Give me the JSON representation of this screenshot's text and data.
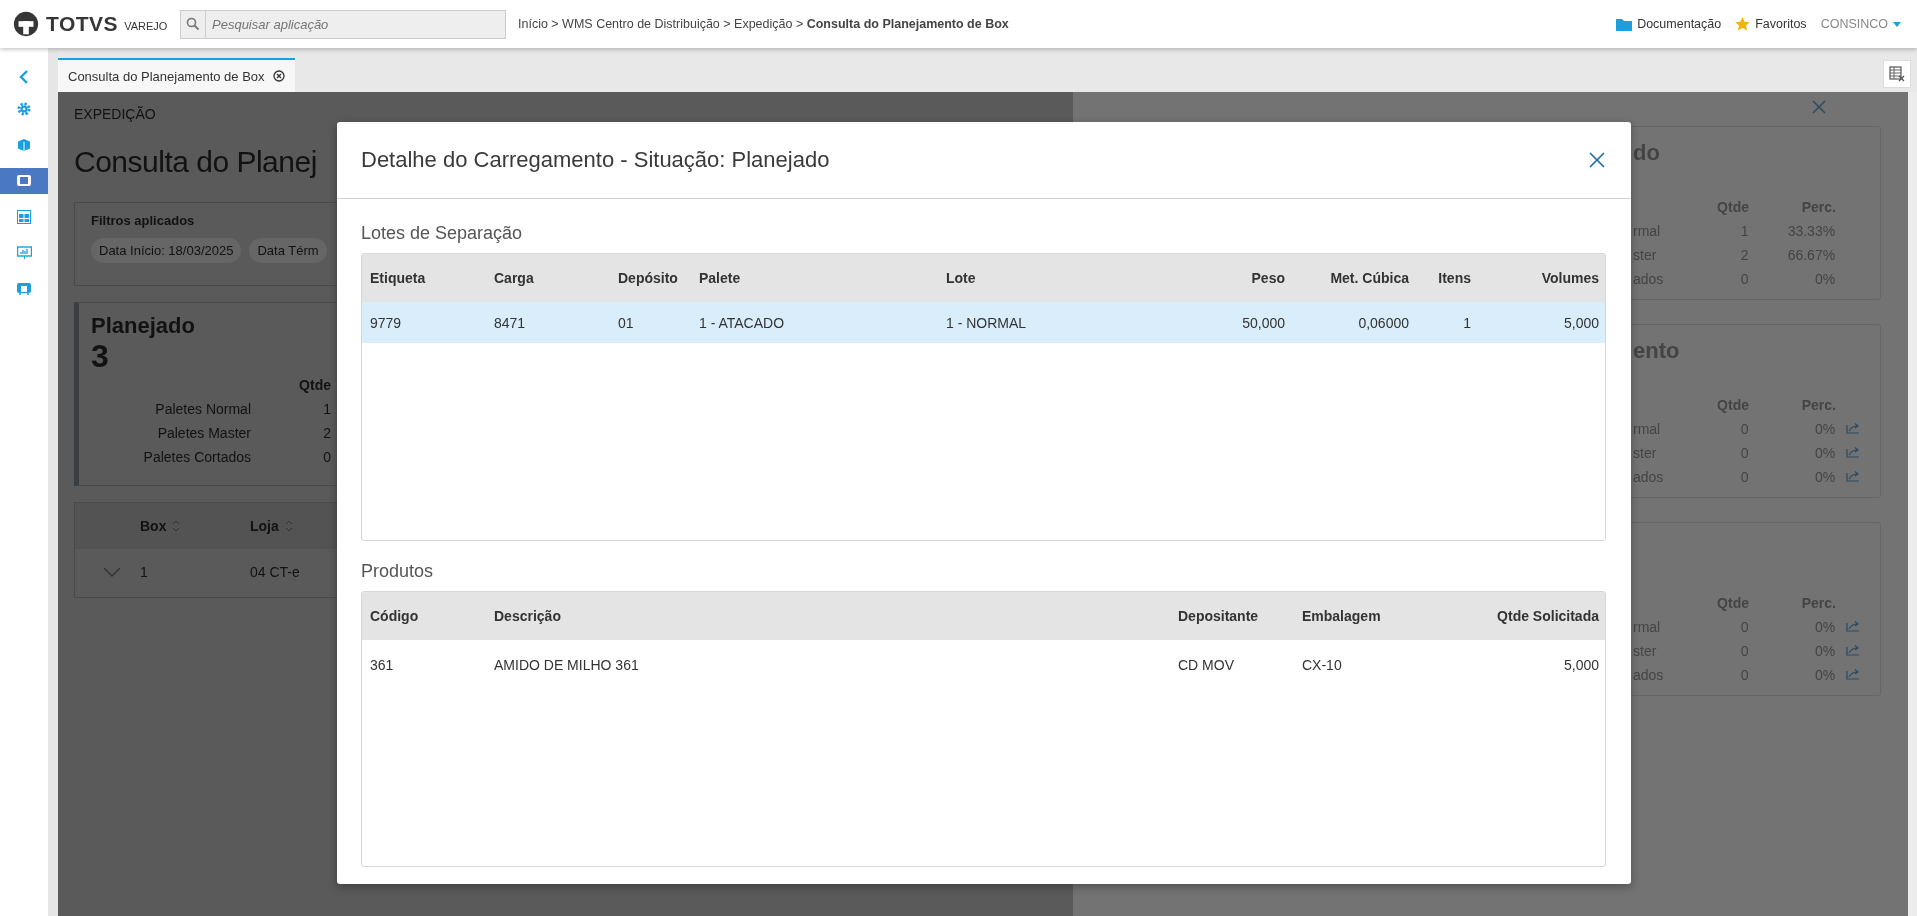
{
  "topbar": {
    "logo": "TOTVS",
    "logo_sub": "VAREJO",
    "search": {
      "placeholder": "Pesquisar aplicação"
    },
    "breadcrumb": "Início > WMS Centro de Distribuição > Expedição > **Consulta do Planejamento de Box**",
    "links": [
      {
        "label": "Documentação",
        "kind": "folder"
      },
      {
        "label": "Favoritos",
        "kind": "star"
      }
    ],
    "user": "CONSINCO"
  },
  "sidebar": {
    "items": [
      {
        "kind": "back",
        "selected": false
      },
      {
        "kind": "gear",
        "selected": false
      },
      {
        "kind": "box",
        "selected": false
      },
      {
        "kind": "screen",
        "selected": true
      },
      {
        "kind": "grid",
        "selected": false
      },
      {
        "kind": "chart",
        "selected": false
      },
      {
        "kind": "monitor",
        "selected": false
      }
    ]
  },
  "tabs": [
    {
      "label": "Consulta do Planejamento de Box",
      "selected": true
    }
  ],
  "page": {
    "section": "EXPEDIÇÃO",
    "title": "Consulta do Planej",
    "filters": {
      "title": "Filtros aplicados",
      "chips": [
        "Data Início: 18/03/2025",
        "Data Térm"
      ]
    },
    "summary": {
      "title": "Planejado",
      "count": "3",
      "column": "Qtde",
      "rows": [
        {
          "label": "Paletes Normal",
          "qtde": "1"
        },
        {
          "label": "Paletes Master",
          "qtde": "2"
        },
        {
          "label": "Paletes Cortados",
          "qtde": "0"
        }
      ]
    },
    "table": {
      "columns": [
        "Box",
        "Loja"
      ],
      "rows": [
        [
          "1",
          "04 CT-e"
        ]
      ]
    }
  },
  "drawer": {
    "cards": [
      {
        "title": "do",
        "columns": [
          "Qtde",
          "Perc."
        ],
        "rows": [
          {
            "label": "rmal",
            "qtde": "1",
            "perc": "33.33%",
            "trend": false
          },
          {
            "label": "ster",
            "qtde": "2",
            "perc": "66.67%",
            "trend": false
          },
          {
            "label": "ados",
            "qtde": "0",
            "perc": "0%",
            "trend": false
          }
        ]
      },
      {
        "title": "ento",
        "columns": [
          "Qtde",
          "Perc."
        ],
        "rows": [
          {
            "label": "rmal",
            "qtde": "0",
            "perc": "0%",
            "trend": true
          },
          {
            "label": "ster",
            "qtde": "0",
            "perc": "0%",
            "trend": true
          },
          {
            "label": "ados",
            "qtde": "0",
            "perc": "0%",
            "trend": true
          }
        ]
      },
      {
        "columns": [
          "Qtde",
          "Perc."
        ],
        "rows": [
          {
            "label": "rmal",
            "qtde": "0",
            "perc": "0%",
            "trend": true
          },
          {
            "label": "ster",
            "qtde": "0",
            "perc": "0%",
            "trend": true
          },
          {
            "label": "ados",
            "qtde": "0",
            "perc": "0%",
            "trend": true
          }
        ]
      }
    ]
  },
  "modal": {
    "title": "Detalhe do Carregamento - Situação: Planejado",
    "lotes": {
      "title": "Lotes de Separação",
      "columns": [
        "Etiqueta",
        "Carga",
        "Depósito",
        "Palete",
        "Lote",
        "Peso",
        "Met. Cúbica",
        "Itens",
        "Volumes"
      ],
      "rows": [
        {
          "cells": [
            "9779",
            "8471",
            "01",
            "1 - ATACADO",
            "1 - NORMAL",
            "50,000",
            "0,06000",
            "1",
            "5,000"
          ],
          "selected": true
        }
      ]
    },
    "produtos": {
      "title": "Produtos",
      "columns": [
        "Código",
        "Descrição",
        "Depositante",
        "Embalagem",
        "Qtde Solicitada"
      ],
      "rows": [
        {
          "cells": [
            "361",
            "AMIDO DE MILHO 361",
            "CD MOV",
            "CX-10",
            "5,000"
          ],
          "selected": false
        }
      ]
    }
  }
}
